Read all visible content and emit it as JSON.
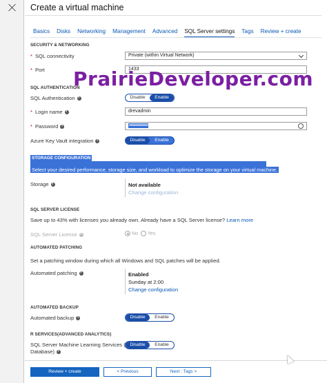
{
  "header": {
    "title": "Create a virtual machine"
  },
  "tabs": [
    {
      "label": "Basics"
    },
    {
      "label": "Disks"
    },
    {
      "label": "Networking"
    },
    {
      "label": "Management"
    },
    {
      "label": "Advanced"
    },
    {
      "label": "SQL Server settings",
      "active": true
    },
    {
      "label": "Tags"
    },
    {
      "label": "Review + create"
    }
  ],
  "security": {
    "heading": "SECURITY & NETWORKING",
    "connectivity_label": "SQL connectivity",
    "connectivity_value": "Private (within Virtual Network)",
    "port_label": "Port",
    "port_value": "1433"
  },
  "auth": {
    "heading": "SQL AUTHENTICATION",
    "sql_auth_label": "SQL Authentication",
    "disable": "Disable",
    "enable": "Enable",
    "login_label": "Login name",
    "login_value": "drevadmin",
    "password_label": "Password",
    "password_value": "••••••••••••••",
    "keyvault_label": "Azure Key Vault integration"
  },
  "storage": {
    "heading": "STORAGE CONFIGURATION",
    "description": "Select your desired performance, storage size, and workload to optimize the storage on your virtual machine.",
    "label": "Storage",
    "status": "Not available",
    "link": "Change configuration"
  },
  "license": {
    "heading": "SQL SERVER LICENSE",
    "text": "Save up to 43% with licenses you already own. Already have a SQL Server license?",
    "link": "Learn more",
    "label": "SQL Server License",
    "no": "No",
    "yes": "Yes"
  },
  "patching": {
    "heading": "AUTOMATED PATCHING",
    "text": "Set a patching window during which all Windows and SQL patches will be applied.",
    "label": "Automated patching",
    "status": "Enabled",
    "schedule": "Sunday at 2:00",
    "link": "Change configuration"
  },
  "backup": {
    "heading": "AUTOMATED BACKUP",
    "label": "Automated backup",
    "disable": "Disable",
    "enable": "Enable"
  },
  "rservices": {
    "heading": "R SERVICES(ADVANCED ANALYTICS)",
    "label_line1": "SQL Server Machine Learning Services (In-",
    "label_line2": "Database)",
    "disable": "Disable",
    "enable": "Enable"
  },
  "footer": {
    "review_create": "Review + create",
    "previous": "< Previous",
    "next": "Next : Tags >"
  },
  "watermark": "PrairieDeveloper.com",
  "colors": {
    "accent": "#0a58b4",
    "toggle": "#1b4ea8",
    "selection": "#3a72d8",
    "watermark": "#7b1fa2"
  }
}
